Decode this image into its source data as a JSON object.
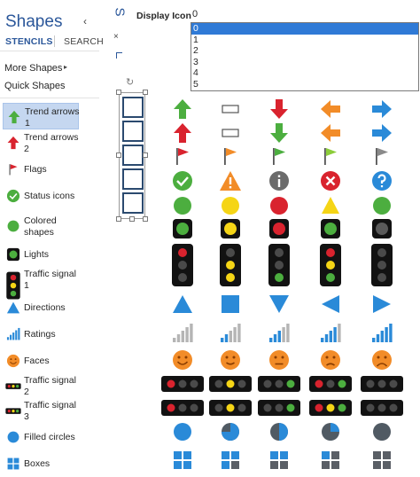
{
  "pane": {
    "title": "Shapes",
    "collapse_glyph": "‹",
    "tab_stencils": "STENCILS",
    "tab_search": "SEARCH",
    "more_shapes": "More Shapes",
    "more_arrow": "▸",
    "quick_shapes": "Quick Shapes"
  },
  "stencils": [
    {
      "label": "Trend arrows 1",
      "icon": "trend-arrow-up-green",
      "selected": true
    },
    {
      "label": "Trend arrows 2",
      "icon": "trend-arrow-up-red"
    },
    {
      "label": "Flags",
      "icon": "flag-red"
    },
    {
      "label": "Status icons",
      "icon": "status-check-green"
    },
    {
      "label": "Colored shapes",
      "icon": "circle-green"
    },
    {
      "label": "Lights",
      "icon": "light-green"
    },
    {
      "label": "Traffic signal 1",
      "icon": "traffic-signal-vertical"
    },
    {
      "label": "Directions",
      "icon": "triangle-blue"
    },
    {
      "label": "Ratings",
      "icon": "bars-blue"
    },
    {
      "label": "Faces",
      "icon": "face-orange"
    },
    {
      "label": "Traffic signal 2",
      "icon": "traffic-signal-horizontal"
    },
    {
      "label": "Traffic signal 3",
      "icon": "traffic-signal-horizontal-2"
    },
    {
      "label": "Filled circles",
      "icon": "circle-blue"
    },
    {
      "label": "Boxes",
      "icon": "boxes-blue"
    }
  ],
  "strip": {
    "s_glyph": "S",
    "x_glyph": "×"
  },
  "display_icon": {
    "label": "Display Icon",
    "value": "0",
    "options": [
      "0",
      "1",
      "2",
      "3",
      "4",
      "5"
    ],
    "selected_index": 0
  },
  "colors": {
    "accent": "#2b579a",
    "green": "#4cae3f",
    "red": "#d9232e",
    "orange": "#f28c28",
    "blue": "#2a8ad8",
    "yellow": "#f5d516",
    "gray": "#8a8a8a",
    "dark": "#121212",
    "selected_bg": "#c5d7f0"
  },
  "icon_grid_rows": [
    [
      "arrow-up-green",
      "rect-outline",
      "arrow-down-red",
      "arrow-left-orange",
      "arrow-right-blue"
    ],
    [
      "arrow-up-red",
      "rect-outline",
      "arrow-down-green",
      "arrow-left-orange",
      "arrow-right-blue"
    ],
    [
      "flag-red",
      "flag-orange",
      "flag-green",
      "flag-lightgreen",
      "flag-gray"
    ],
    [
      "status-check-green",
      "status-warning-orange",
      "status-info-gray",
      "status-error-red",
      "status-help-blue"
    ],
    [
      "circle-green",
      "circle-yellow",
      "circle-red",
      "triangle-yellow",
      "circle-green"
    ],
    [
      "light-green",
      "light-yellow",
      "light-red",
      "light-green",
      "light-gray"
    ],
    [
      "signal-v-red",
      "signal-v-yellow",
      "signal-v-green",
      "signal-v-ryg",
      "signal-v-off"
    ],
    [
      "triangle-up-blue",
      "square-blue",
      "triangle-down-blue",
      "triangle-left-blue",
      "triangle-right-blue"
    ],
    [
      "ratings-0",
      "ratings-1",
      "ratings-2",
      "ratings-3",
      "ratings-4"
    ],
    [
      "face-happy",
      "face-smile",
      "face-neutral",
      "face-sad",
      "face-upset"
    ],
    [
      "signal-h-red",
      "signal-h-yellow",
      "signal-h-green",
      "signal-h-rg",
      "signal-h-off"
    ],
    [
      "signal-h-red",
      "signal-h-yellow",
      "signal-h-green",
      "signal-h-ryg",
      "signal-h-off"
    ],
    [
      "pie-100",
      "pie-75",
      "pie-50",
      "pie-25",
      "pie-0"
    ],
    [
      "boxes-4",
      "boxes-3",
      "boxes-2",
      "boxes-1",
      "boxes-0"
    ]
  ]
}
